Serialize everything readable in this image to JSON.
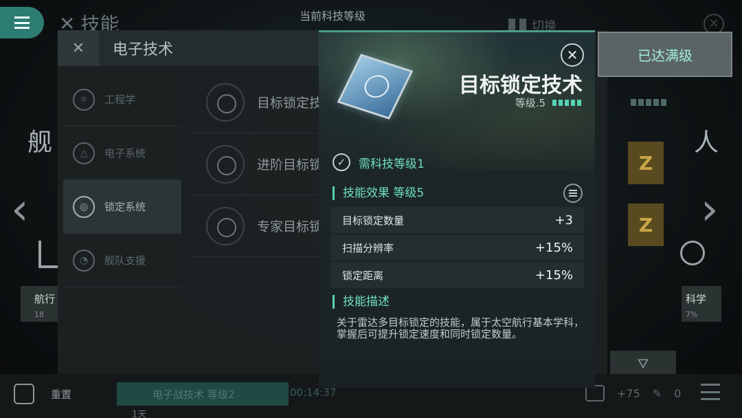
{
  "top": {
    "title": "技能",
    "center_label": "当前科技等级",
    "switch_label": "切换"
  },
  "background": {
    "left_big_text": "舰",
    "right_big_text": "人",
    "left_card": {
      "label": "航行",
      "sub": "18"
    },
    "right_card": {
      "label": "科学",
      "sub": "7%"
    }
  },
  "left_panel": {
    "title": "电子技术",
    "tabs": [
      {
        "label": "工程学",
        "active": false
      },
      {
        "label": "电子系统",
        "active": false
      },
      {
        "label": "锁定系统",
        "active": true
      },
      {
        "label": "舰队支援",
        "active": false
      }
    ],
    "skills": [
      {
        "label": "目标锁定技"
      },
      {
        "label": "进阶目标锁"
      },
      {
        "label": "专家目标锁"
      }
    ]
  },
  "max_level_button": "已达满级",
  "zbox_glyph": "Z",
  "bottom_bar": {
    "reset_label": "重置",
    "progress_label": "电子战技术 等级2",
    "timer": "00:14:37",
    "day_label": "1天",
    "currency_value": "+75",
    "item_value": "0"
  },
  "modal": {
    "title": "目标锁定技术",
    "level_label": "等级.5",
    "level_dots": 5,
    "requirement": "需科技等级1",
    "effects_title": "技能效果 等级5",
    "effects": [
      {
        "name": "目标锁定数量",
        "value": "+3"
      },
      {
        "name": "扫描分辨率",
        "value": "+15%"
      },
      {
        "name": "锁定距离",
        "value": "+15%"
      }
    ],
    "description_title": "技能描述",
    "description": "关于雷达多目标锁定的技能，属于太空航行基本学科，掌握后可提升锁定速度和同时锁定数量。"
  },
  "colors": {
    "accent": "#57d2b2",
    "accent_text": "#6ee0c0",
    "menu_button": "#2d7c72"
  }
}
